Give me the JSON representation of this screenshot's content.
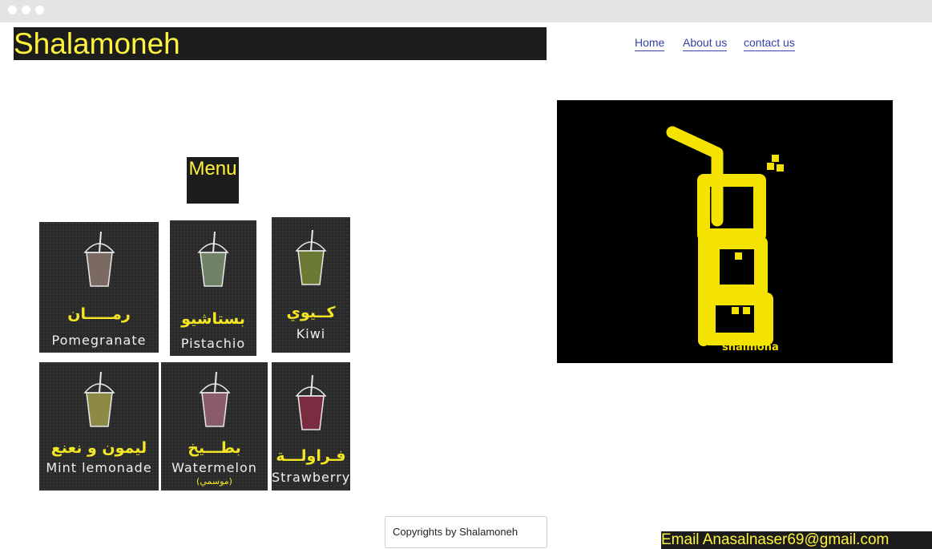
{
  "header": {
    "brand": "Shalamoneh"
  },
  "nav": {
    "items": [
      "Home",
      "About us",
      "contact us"
    ]
  },
  "menu": {
    "title": "Menu",
    "items": [
      {
        "arabic": "رمـــــان",
        "english": "Pomegranate",
        "note": "",
        "liquid": "#7a6a62"
      },
      {
        "arabic": "بستاشيو",
        "english": "Pistachio",
        "note": "",
        "liquid": "#6f8166"
      },
      {
        "arabic": "كــيوي",
        "english": "Kiwi",
        "note": "",
        "liquid": "#6b7a33"
      },
      {
        "arabic": "ليمون و نعنع",
        "english": "Mint lemonade",
        "note": "",
        "liquid": "#8d8a45"
      },
      {
        "arabic": "بطـــيخ",
        "english": "Watermelon",
        "note": "(موسمي)",
        "liquid": "#8a5b6a"
      },
      {
        "arabic": "فـراولـــة",
        "english": "Strawberry",
        "note": "",
        "liquid": "#7a2c40"
      }
    ]
  },
  "logo": {
    "text": "shalmona",
    "color": "#f4e300"
  },
  "footer": {
    "copyright": "Copyrights by Shalamoneh",
    "email": "Email  Anasalnaser69@gmail.com"
  },
  "colors": {
    "accent": "#fff33d",
    "dark": "#1c1c1c",
    "link": "#3341a8"
  }
}
